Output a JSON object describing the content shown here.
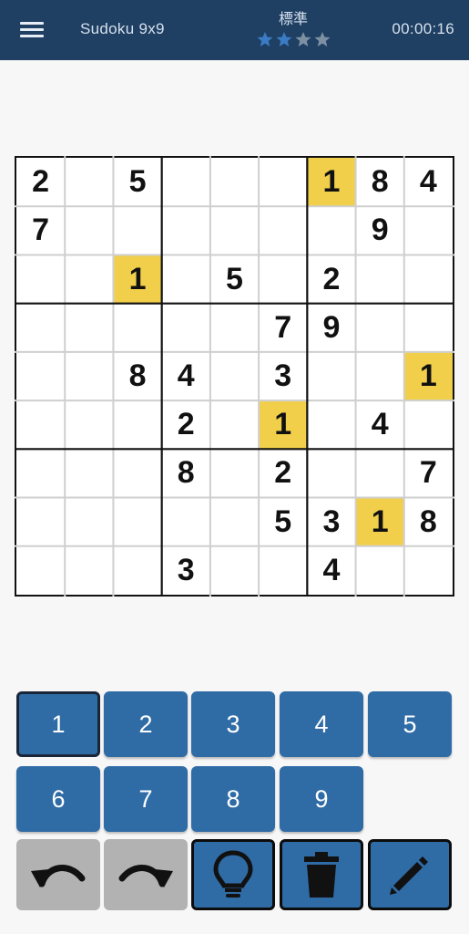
{
  "header": {
    "app_title": "Sudoku 9x9",
    "difficulty_label": "標準",
    "difficulty_stars_filled": 2,
    "difficulty_stars_total": 4,
    "timer": "00:00:16"
  },
  "board": {
    "rows": [
      [
        "2",
        "",
        "5",
        "",
        "",
        "",
        "1",
        "8",
        "4"
      ],
      [
        "7",
        "",
        "",
        "",
        "",
        "",
        "",
        "9",
        ""
      ],
      [
        "",
        "",
        "1",
        "",
        "5",
        "",
        "2",
        "",
        ""
      ],
      [
        "",
        "",
        "",
        "",
        "",
        "7",
        "9",
        "",
        ""
      ],
      [
        "",
        "",
        "8",
        "4",
        "",
        "3",
        "",
        "",
        "1"
      ],
      [
        "",
        "",
        "",
        "2",
        "",
        "1",
        "",
        "4",
        ""
      ],
      [
        "",
        "",
        "",
        "8",
        "",
        "2",
        "",
        "",
        "7"
      ],
      [
        "",
        "",
        "",
        "",
        "",
        "5",
        "3",
        "1",
        "8"
      ],
      [
        "",
        "",
        "",
        "3",
        "",
        "",
        "4",
        "",
        ""
      ]
    ],
    "highlighted_digit": "1",
    "highlight_color": "#f1cf4a"
  },
  "number_pad": {
    "labels": [
      "1",
      "2",
      "3",
      "4",
      "5",
      "6",
      "7",
      "8",
      "9"
    ],
    "selected": "1"
  },
  "toolbar": {
    "items": [
      {
        "icon": "undo-icon"
      },
      {
        "icon": "redo-icon"
      },
      {
        "icon": "lightbulb-icon"
      },
      {
        "icon": "trash-icon"
      },
      {
        "icon": "pencil-icon"
      }
    ]
  },
  "colors": {
    "header_bg": "#1f3f63",
    "button_blue": "#2f6ca6",
    "button_gray": "#b2b2b2",
    "star_filled": "#3a7cc4",
    "star_empty": "#7d8fa3"
  }
}
